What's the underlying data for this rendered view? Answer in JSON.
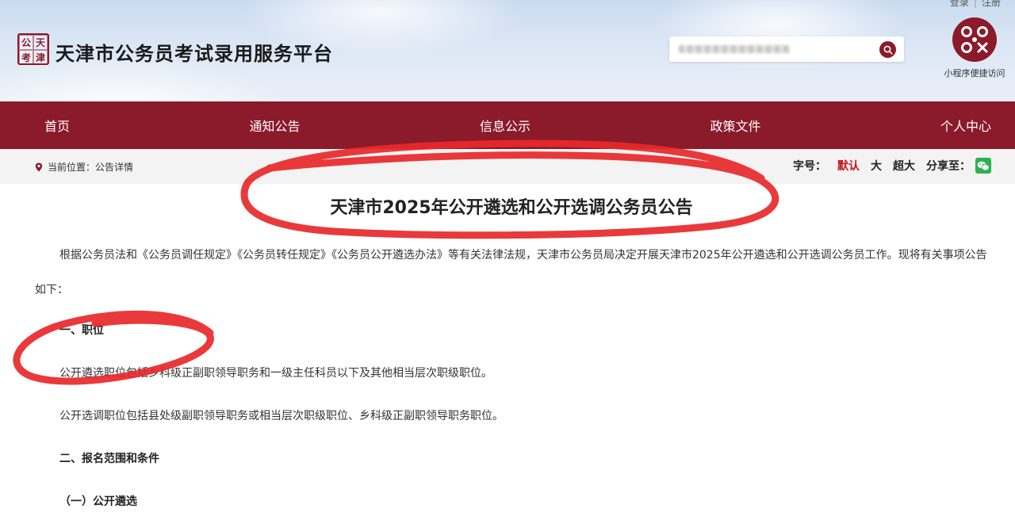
{
  "header": {
    "top_links": [
      "登录",
      "注册"
    ],
    "logo_chars": [
      "公",
      "天",
      "考",
      "津"
    ],
    "site_title": "天津市公务员考试录用服务平台",
    "search": {
      "placeholder": ""
    },
    "qr_label": "小程序便捷访问"
  },
  "nav": {
    "items": [
      "首页",
      "通知公告",
      "信息公示",
      "政策文件",
      "个人中心"
    ]
  },
  "breadcrumb": {
    "text": "当前位置：公告详情"
  },
  "tools": {
    "font_label": "字号：",
    "font_default": "默认",
    "font_large": "大",
    "font_xlarge": "超大",
    "share_label": "分享至："
  },
  "article": {
    "title": "天津市2025年公开遴选和公开选调公务员公告",
    "intro": "根据公务员法和《公务员调任规定》《公务员转任规定》《公务员公开遴选办法》等有关法律法规，天津市公务员局决定开展天津市2025年公开遴选和公开选调公务员工作。现将有关事项公告如下：",
    "section1_title": "一、职位",
    "section1_p1": "公开遴选职位包括乡科级正副职领导职务和一级主任科员以下及其他相当层次职级职位。",
    "section1_p2": "公开选调职位包括县处级副职领导职务或相当层次职级职位、乡科级正副职领导职务职位。",
    "section2_title": "二、报名范围和条件",
    "section2_sub1": "（一）公开遴选"
  },
  "colors": {
    "brand": "#8b1a2b",
    "active_font": "#c4161c",
    "wechat": "#2bb24c",
    "marker": "#e8282a"
  }
}
